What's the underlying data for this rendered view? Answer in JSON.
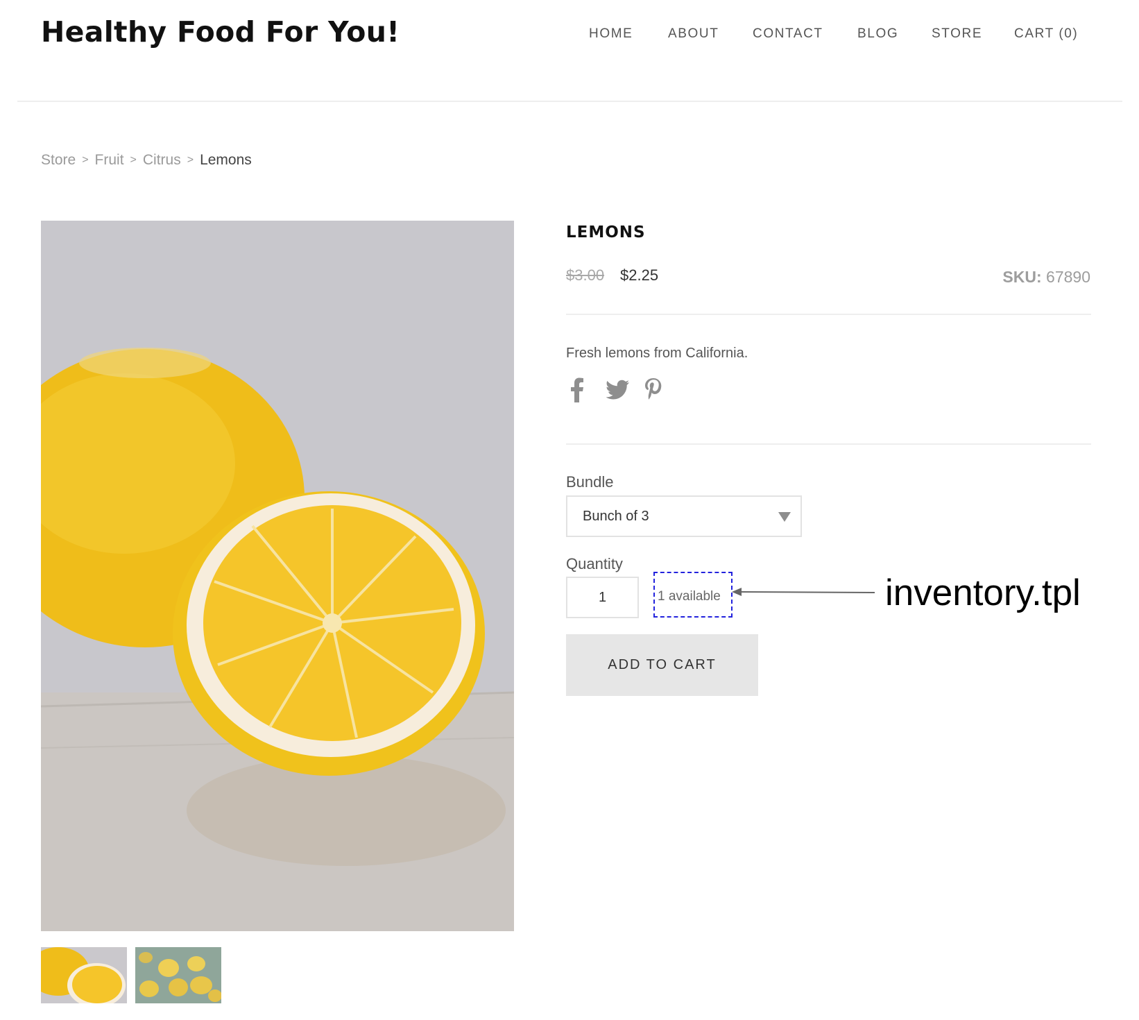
{
  "header": {
    "site_title": "Healthy Food For You!",
    "nav": [
      {
        "label": "HOME"
      },
      {
        "label": "ABOUT"
      },
      {
        "label": "CONTACT"
      },
      {
        "label": "BLOG"
      },
      {
        "label": "STORE"
      },
      {
        "label": "CART (0)"
      }
    ]
  },
  "breadcrumb": {
    "items": [
      "Store",
      "Fruit",
      "Citrus"
    ],
    "separator": ">",
    "current": "Lemons"
  },
  "product": {
    "title": "LEMONS",
    "original_price": "$3.00",
    "sale_price": "$2.25",
    "sku_label": "SKU:",
    "sku_value": "67890",
    "description": "Fresh lemons from California.",
    "share_icons": [
      "facebook-icon",
      "twitter-icon",
      "pinterest-icon"
    ],
    "bundle_label": "Bundle",
    "bundle_value": "Bunch of 3",
    "quantity_label": "Quantity",
    "quantity_value": "1",
    "inventory_text": "1 available",
    "add_to_cart_label": "ADD TO CART",
    "images": [
      "lemons-halved-photo",
      "lemon-tree-photo"
    ]
  },
  "annotation": {
    "label": "inventory.tpl",
    "highlight_color": "#2222dd"
  },
  "colors": {
    "text_dark": "#111111",
    "text_muted": "#9a9a9a",
    "button_bg": "#e6e6e6",
    "divider": "#eeeeee",
    "lemon_yellow": "#f3c318"
  }
}
